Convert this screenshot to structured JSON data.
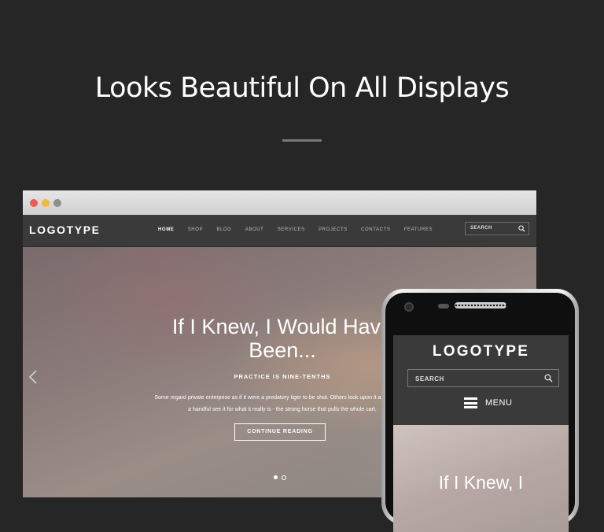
{
  "headline": "Looks Beautiful On All Displays",
  "desktop": {
    "logo": "LOGOTYPE",
    "nav": [
      {
        "label": "HOME",
        "active": true
      },
      {
        "label": "SHOP"
      },
      {
        "label": "BLOG"
      },
      {
        "label": "ABOUT"
      },
      {
        "label": "SERVICES"
      },
      {
        "label": "PROJECTS"
      },
      {
        "label": "CONTACTS"
      },
      {
        "label": "FEATURES"
      }
    ],
    "search_placeholder": "SEARCH",
    "hero": {
      "title_line1": "If I Knew, I Would Have",
      "title_line2": "Been...",
      "subtitle": "PRACTICE IS NINE-TENTHS",
      "text_line1": "Some regard private enterprise as if it were a predatory tiger to be shot. Others look upon it as a cow that",
      "text_line2": "a handful see it for what it really is - the strong horse that pulls the whole cart.",
      "cta": "CONTINUE READING",
      "slide_count": 2,
      "active_slide": 1
    },
    "window_buttons": [
      "red",
      "yellow",
      "gray"
    ]
  },
  "mobile": {
    "logo": "LOGOTYPE",
    "search_placeholder": "SEARCH",
    "menu_label": "MENU",
    "hero_title": "If I Knew, I"
  },
  "icons": {
    "search": "search-icon",
    "menu": "hamburger-icon",
    "prev": "chevron-left-icon"
  },
  "colors": {
    "background": "#262626",
    "navbar": "#3a3a3a",
    "close": "#ec5d53",
    "minimize": "#f0bb3c",
    "maximize": "#8e8e8e"
  }
}
